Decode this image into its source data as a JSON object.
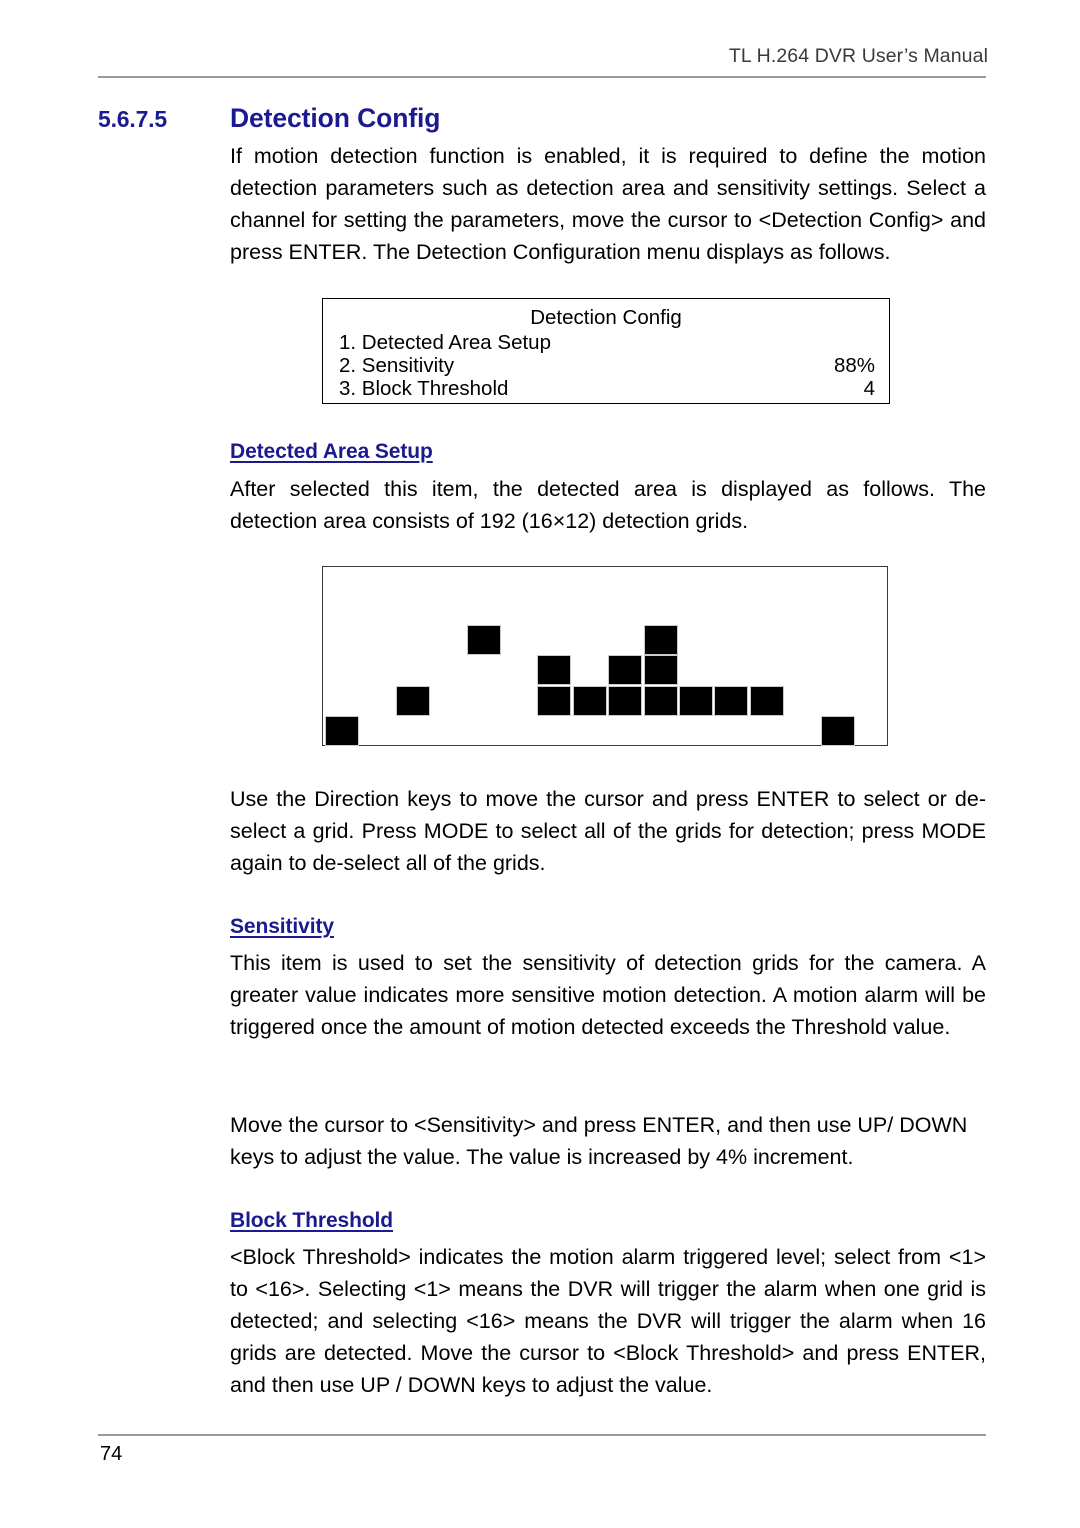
{
  "header": {
    "title": "TL H.264 DVR User’s Manual"
  },
  "section": {
    "number": "5.6.7.5",
    "title": "Detection Config",
    "intro": "If motion detection function is enabled, it is required to define the motion detection parameters such as detection area and sensitivity settings. Select a channel for setting the parameters, move the cursor to <Detection Config> and press ENTER. The Detection Configuration menu displays as follows."
  },
  "osd_menu": {
    "title": "Detection Config",
    "rows": [
      {
        "label": "1. Detected Area Setup",
        "value": ""
      },
      {
        "label": "2. Sensitivity",
        "value": "88%"
      },
      {
        "label": "3. Block Threshold",
        "value": "4"
      }
    ]
  },
  "detected_area": {
    "heading": "Detected Area Setup",
    "body": "After selected this item, the detected area is displayed as follows. The detection area consists of 192 (16×12) detection grids.",
    "grid": {
      "columns": 16,
      "rows": 12,
      "selected_cells": [
        {
          "col": 5,
          "row": 2
        },
        {
          "col": 10,
          "row": 2
        },
        {
          "col": 7,
          "row": 3
        },
        {
          "col": 9,
          "row": 3
        },
        {
          "col": 10,
          "row": 3
        },
        {
          "col": 3,
          "row": 4
        },
        {
          "col": 7,
          "row": 4
        },
        {
          "col": 8,
          "row": 4
        },
        {
          "col": 9,
          "row": 4
        },
        {
          "col": 10,
          "row": 4
        },
        {
          "col": 11,
          "row": 4
        },
        {
          "col": 12,
          "row": 4
        },
        {
          "col": 13,
          "row": 4
        },
        {
          "col": 1,
          "row": 5
        },
        {
          "col": 15,
          "row": 5
        }
      ]
    },
    "instructions": "Use the Direction keys to move the cursor and press ENTER to select or de-select a grid. Press MODE to select all of the grids for detection; press MODE again to de-select all of the grids."
  },
  "sensitivity": {
    "heading": "Sensitivity",
    "body": "This item is used to set the sensitivity of detection grids for the camera. A greater value indicates more sensitive motion detection. A motion alarm will be triggered once the amount of motion detected exceeds the Threshold value.",
    "body2": "Move the cursor to <Sensitivity> and press ENTER, and then use UP/ DOWN keys to adjust the value. The value is increased by 4% increment."
  },
  "block_threshold": {
    "heading": "Block Threshold",
    "body": "<Block Threshold> indicates the motion alarm triggered level; select from <1> to <16>. Selecting <1> means the DVR will trigger the alarm when one grid is detected; and selecting <16> means the DVR will trigger the alarm when 16 grids are detected. Move the cursor to <Block Threshold> and press ENTER, and then use UP / DOWN keys to adjust the value."
  },
  "footer": {
    "page_number": "74"
  },
  "colors": {
    "heading_blue": "#1b1b8f",
    "rule_gray": "#9a9a9a",
    "cell_black": "#000000"
  }
}
